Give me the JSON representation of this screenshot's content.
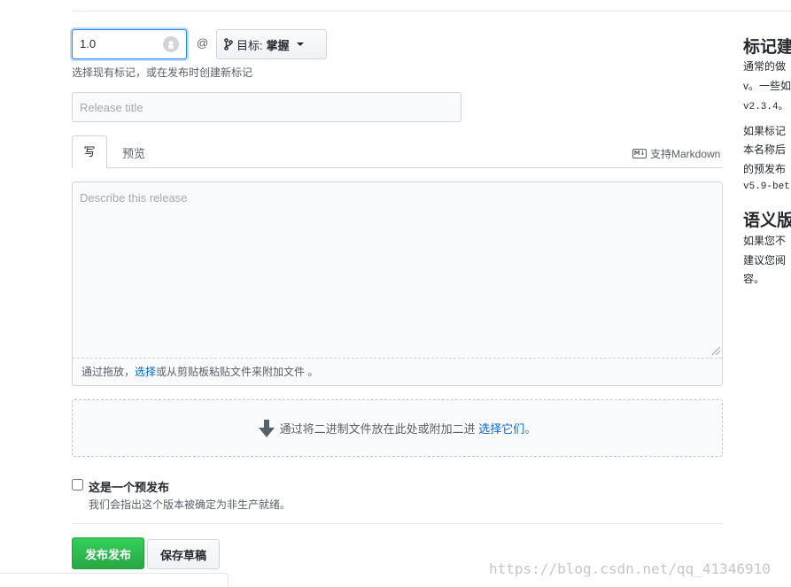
{
  "tag": {
    "value": "1.0",
    "at_symbol": "@",
    "target_prefix": "目标:",
    "target_branch": "掌握",
    "hint": "选择现有标记，或在发布时创建新标记"
  },
  "release_title": {
    "placeholder": "Release title"
  },
  "tabs": {
    "write": "写",
    "preview": "预览"
  },
  "markdown_hint": {
    "icon_text": "M↓",
    "label": "支持Markdown"
  },
  "description": {
    "placeholder": "Describe this release",
    "attach_before": "通过拖放，",
    "attach_link": "选择",
    "attach_after": "或从剪贴板粘贴文件来附加文件 。"
  },
  "binaries": {
    "text": "通过将二进制文件放在此处或附加二进 ",
    "link": "选择它们",
    "suffix": "。"
  },
  "prerelease": {
    "label": "这是一个预发布",
    "note": "我们会指出这个版本被确定为非生产就绪。"
  },
  "buttons": {
    "publish": "发布发布",
    "save_draft": "保存草稿"
  },
  "sidebar": {
    "heading1": "标记建",
    "line1": "通常的做",
    "line2": "v。一些如",
    "line3": "v2.3.4。",
    "line4": "如果标记",
    "line5": "本名称后",
    "line6": "的预发布",
    "line7": "v5.9-bet",
    "heading2": "语义版",
    "line8": "如果您不",
    "line9": "建议您阅",
    "line10": "容。"
  },
  "watermark": "https://blog.csdn.net/qq_41346910"
}
